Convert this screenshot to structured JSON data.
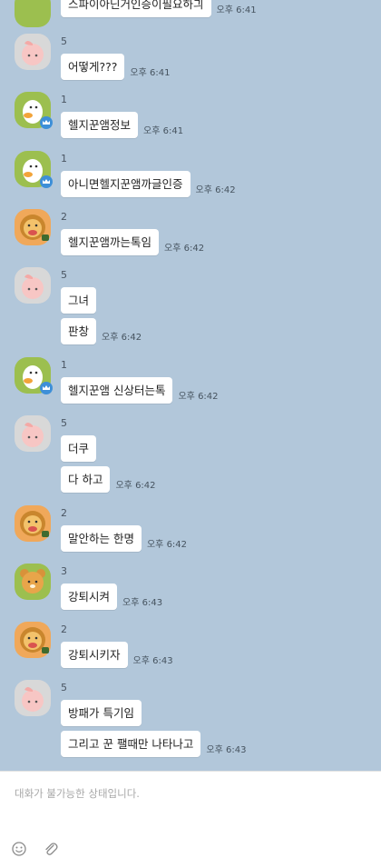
{
  "messages": [
    {
      "avatar": "crown-duck",
      "sender": "",
      "text": "스파이아닌거인증이필요하긔",
      "time": "오후 6:41"
    },
    {
      "avatar": "peach",
      "sender": "5",
      "text": "어떻게???",
      "time": "오후 6:41"
    },
    {
      "avatar": "crown-duck",
      "sender": "1",
      "text": "헬지꾼앰정보",
      "time": "오후 6:41"
    },
    {
      "avatar": "crown-duck",
      "sender": "1",
      "text": "아니면헬지꾼앰까글인증",
      "time": "오후 6:42"
    },
    {
      "avatar": "lion",
      "sender": "2",
      "text": "헬지꾼앰까는톡임",
      "time": "오후 6:42"
    },
    {
      "avatar": "peach",
      "sender": "5",
      "text": "그녀",
      "time": ""
    },
    {
      "avatar": "",
      "sender": "",
      "text": "판창",
      "time": "오후 6:42"
    },
    {
      "avatar": "crown-duck",
      "sender": "1",
      "text": "헬지꾼앰 신상터는톡",
      "time": "오후 6:42"
    },
    {
      "avatar": "peach",
      "sender": "5",
      "text": "더쿠",
      "time": ""
    },
    {
      "avatar": "",
      "sender": "",
      "text": "다 하고",
      "time": "오후 6:42"
    },
    {
      "avatar": "lion",
      "sender": "2",
      "text": "말안하는 한명",
      "time": "오후 6:42"
    },
    {
      "avatar": "ryan",
      "sender": "3",
      "text": "강퇴시켜",
      "time": "오후 6:43"
    },
    {
      "avatar": "lion",
      "sender": "2",
      "text": "강퇴시키자",
      "time": "오후 6:43"
    },
    {
      "avatar": "peach",
      "sender": "5",
      "text": "방패가 특기임",
      "time": ""
    },
    {
      "avatar": "",
      "sender": "",
      "text": "그리고 꾼 팰때만 나타나고",
      "time": "오후 6:43"
    }
  ],
  "composer": {
    "placeholder": "대화가 불가능한 상태입니다.",
    "emoji_icon": "smiley-icon",
    "attach_icon": "paperclip-icon"
  },
  "colors": {
    "chat_bg": "#b2c7da",
    "bubble_bg": "#ffffff",
    "badge": "#3d8fd8"
  }
}
